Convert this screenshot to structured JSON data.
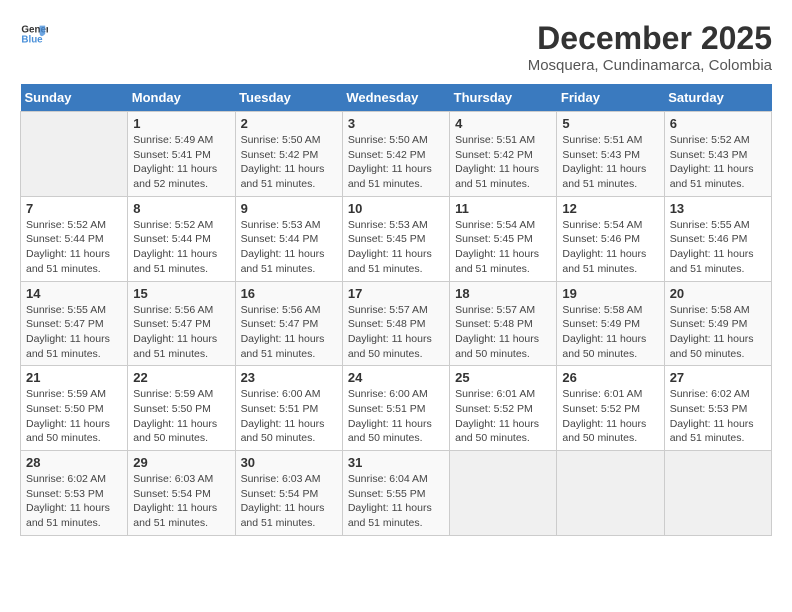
{
  "logo": {
    "line1": "General",
    "line2": "Blue"
  },
  "title": "December 2025",
  "subtitle": "Mosquera, Cundinamarca, Colombia",
  "days_of_week": [
    "Sunday",
    "Monday",
    "Tuesday",
    "Wednesday",
    "Thursday",
    "Friday",
    "Saturday"
  ],
  "weeks": [
    [
      {
        "day": "",
        "info": ""
      },
      {
        "day": "1",
        "info": "Sunrise: 5:49 AM\nSunset: 5:41 PM\nDaylight: 11 hours\nand 52 minutes."
      },
      {
        "day": "2",
        "info": "Sunrise: 5:50 AM\nSunset: 5:42 PM\nDaylight: 11 hours\nand 51 minutes."
      },
      {
        "day": "3",
        "info": "Sunrise: 5:50 AM\nSunset: 5:42 PM\nDaylight: 11 hours\nand 51 minutes."
      },
      {
        "day": "4",
        "info": "Sunrise: 5:51 AM\nSunset: 5:42 PM\nDaylight: 11 hours\nand 51 minutes."
      },
      {
        "day": "5",
        "info": "Sunrise: 5:51 AM\nSunset: 5:43 PM\nDaylight: 11 hours\nand 51 minutes."
      },
      {
        "day": "6",
        "info": "Sunrise: 5:52 AM\nSunset: 5:43 PM\nDaylight: 11 hours\nand 51 minutes."
      }
    ],
    [
      {
        "day": "7",
        "info": "Sunrise: 5:52 AM\nSunset: 5:44 PM\nDaylight: 11 hours\nand 51 minutes."
      },
      {
        "day": "8",
        "info": "Sunrise: 5:52 AM\nSunset: 5:44 PM\nDaylight: 11 hours\nand 51 minutes."
      },
      {
        "day": "9",
        "info": "Sunrise: 5:53 AM\nSunset: 5:44 PM\nDaylight: 11 hours\nand 51 minutes."
      },
      {
        "day": "10",
        "info": "Sunrise: 5:53 AM\nSunset: 5:45 PM\nDaylight: 11 hours\nand 51 minutes."
      },
      {
        "day": "11",
        "info": "Sunrise: 5:54 AM\nSunset: 5:45 PM\nDaylight: 11 hours\nand 51 minutes."
      },
      {
        "day": "12",
        "info": "Sunrise: 5:54 AM\nSunset: 5:46 PM\nDaylight: 11 hours\nand 51 minutes."
      },
      {
        "day": "13",
        "info": "Sunrise: 5:55 AM\nSunset: 5:46 PM\nDaylight: 11 hours\nand 51 minutes."
      }
    ],
    [
      {
        "day": "14",
        "info": "Sunrise: 5:55 AM\nSunset: 5:47 PM\nDaylight: 11 hours\nand 51 minutes."
      },
      {
        "day": "15",
        "info": "Sunrise: 5:56 AM\nSunset: 5:47 PM\nDaylight: 11 hours\nand 51 minutes."
      },
      {
        "day": "16",
        "info": "Sunrise: 5:56 AM\nSunset: 5:47 PM\nDaylight: 11 hours\nand 51 minutes."
      },
      {
        "day": "17",
        "info": "Sunrise: 5:57 AM\nSunset: 5:48 PM\nDaylight: 11 hours\nand 50 minutes."
      },
      {
        "day": "18",
        "info": "Sunrise: 5:57 AM\nSunset: 5:48 PM\nDaylight: 11 hours\nand 50 minutes."
      },
      {
        "day": "19",
        "info": "Sunrise: 5:58 AM\nSunset: 5:49 PM\nDaylight: 11 hours\nand 50 minutes."
      },
      {
        "day": "20",
        "info": "Sunrise: 5:58 AM\nSunset: 5:49 PM\nDaylight: 11 hours\nand 50 minutes."
      }
    ],
    [
      {
        "day": "21",
        "info": "Sunrise: 5:59 AM\nSunset: 5:50 PM\nDaylight: 11 hours\nand 50 minutes."
      },
      {
        "day": "22",
        "info": "Sunrise: 5:59 AM\nSunset: 5:50 PM\nDaylight: 11 hours\nand 50 minutes."
      },
      {
        "day": "23",
        "info": "Sunrise: 6:00 AM\nSunset: 5:51 PM\nDaylight: 11 hours\nand 50 minutes."
      },
      {
        "day": "24",
        "info": "Sunrise: 6:00 AM\nSunset: 5:51 PM\nDaylight: 11 hours\nand 50 minutes."
      },
      {
        "day": "25",
        "info": "Sunrise: 6:01 AM\nSunset: 5:52 PM\nDaylight: 11 hours\nand 50 minutes."
      },
      {
        "day": "26",
        "info": "Sunrise: 6:01 AM\nSunset: 5:52 PM\nDaylight: 11 hours\nand 50 minutes."
      },
      {
        "day": "27",
        "info": "Sunrise: 6:02 AM\nSunset: 5:53 PM\nDaylight: 11 hours\nand 51 minutes."
      }
    ],
    [
      {
        "day": "28",
        "info": "Sunrise: 6:02 AM\nSunset: 5:53 PM\nDaylight: 11 hours\nand 51 minutes."
      },
      {
        "day": "29",
        "info": "Sunrise: 6:03 AM\nSunset: 5:54 PM\nDaylight: 11 hours\nand 51 minutes."
      },
      {
        "day": "30",
        "info": "Sunrise: 6:03 AM\nSunset: 5:54 PM\nDaylight: 11 hours\nand 51 minutes."
      },
      {
        "day": "31",
        "info": "Sunrise: 6:04 AM\nSunset: 5:55 PM\nDaylight: 11 hours\nand 51 minutes."
      },
      {
        "day": "",
        "info": ""
      },
      {
        "day": "",
        "info": ""
      },
      {
        "day": "",
        "info": ""
      }
    ]
  ]
}
